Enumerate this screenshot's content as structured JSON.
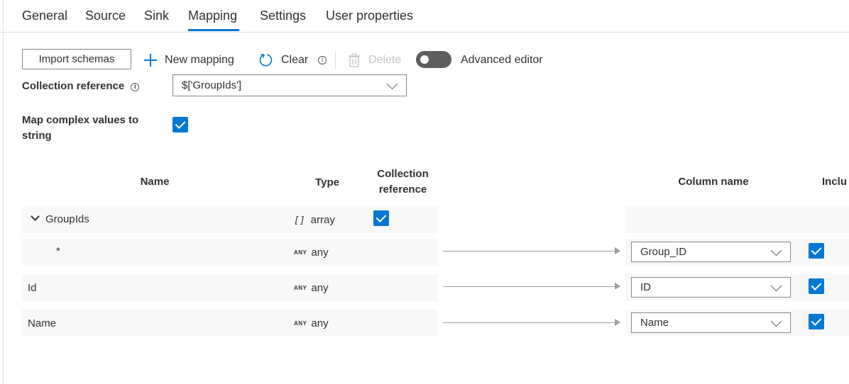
{
  "tabs": [
    {
      "label": "General"
    },
    {
      "label": "Source"
    },
    {
      "label": "Sink"
    },
    {
      "label": "Mapping"
    },
    {
      "label": "Settings"
    },
    {
      "label": "User properties"
    }
  ],
  "active_tab": "Mapping",
  "toolbar": {
    "import_label": "Import schemas",
    "new_mapping_label": "New mapping",
    "clear_label": "Clear",
    "delete_label": "Delete",
    "advanced_editor_label": "Advanced editor",
    "advanced_editor_on": false
  },
  "collection_reference": {
    "label": "Collection reference",
    "value": "$['GroupIds']"
  },
  "map_complex": {
    "label_line1": "Map complex values to",
    "label_line2": "string",
    "checked": true
  },
  "table": {
    "headers": {
      "name": "Name",
      "type": "Type",
      "collection_line1": "Collection",
      "collection_line2": "reference",
      "column_name": "Column name",
      "include": "Inclu"
    },
    "rows": [
      {
        "name": "GroupIds",
        "type_tag": "[]",
        "type": "array",
        "collection_ref": true,
        "column": "",
        "include": false
      },
      {
        "name": "*",
        "type_tag": "ANY",
        "type": "any",
        "collection_ref": false,
        "column": "Group_ID",
        "include": true
      },
      {
        "name": "Id",
        "type_tag": "ANY",
        "type": "any",
        "collection_ref": false,
        "column": "ID",
        "include": true
      },
      {
        "name": "Name",
        "type_tag": "ANY",
        "type": "any",
        "collection_ref": false,
        "column": "Name",
        "include": true
      }
    ]
  },
  "colors": {
    "accent": "#0078d4",
    "row_bg": "#f8f8f8",
    "border": "#8a8886"
  },
  "icons": [
    "plus-icon",
    "refresh-icon",
    "info-icon",
    "trash-icon",
    "chevron-down-icon",
    "checkmark-icon",
    "arrow-right-icon"
  ]
}
